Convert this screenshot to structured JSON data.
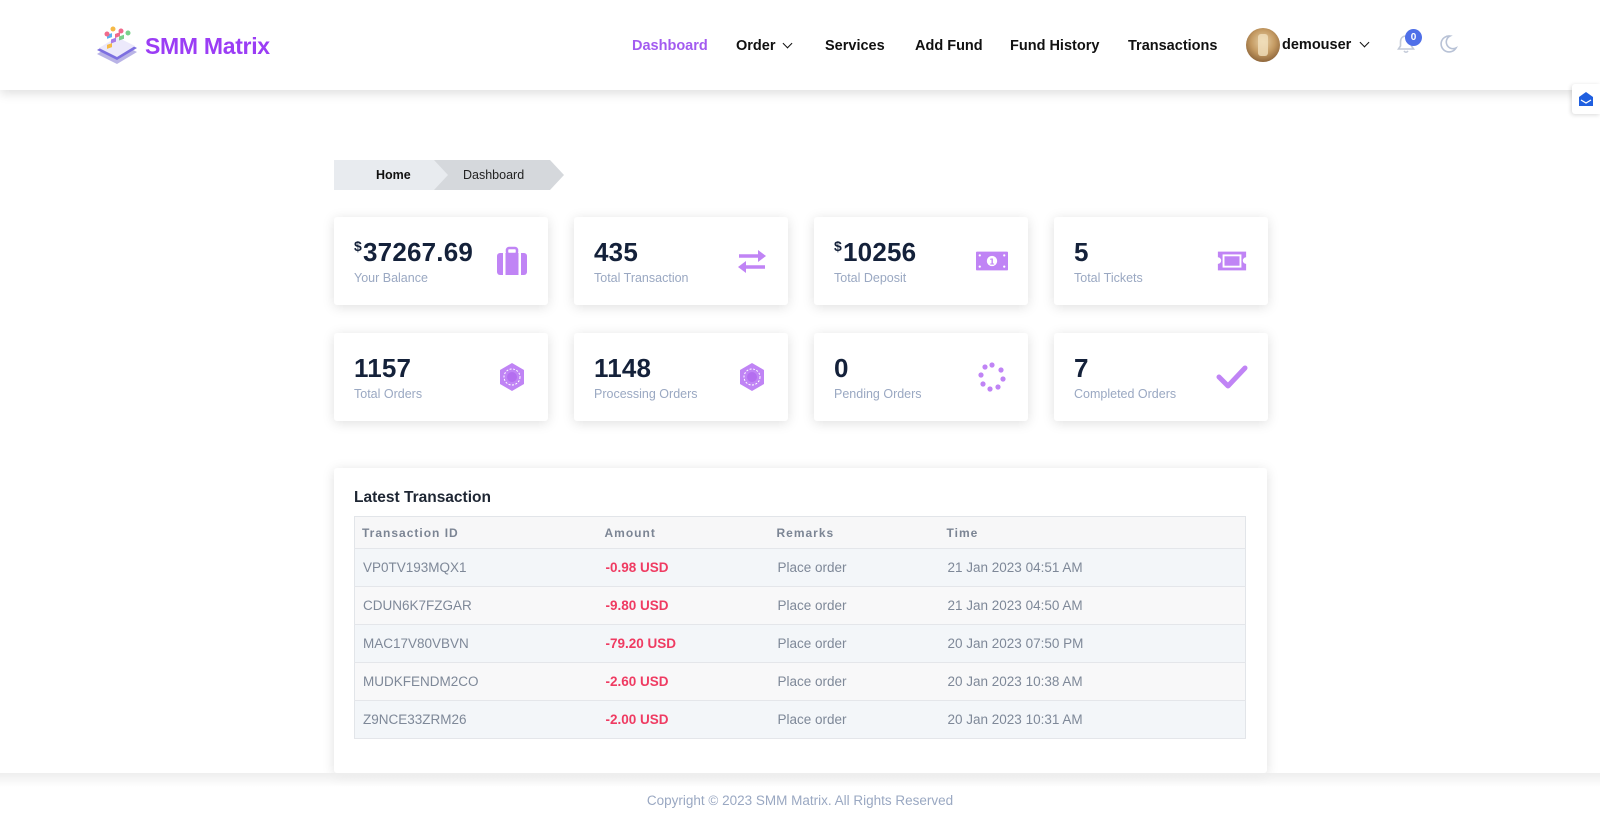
{
  "brand": {
    "name": "SMM Matrix",
    "accent_color": "#9b3df5"
  },
  "nav": {
    "items": [
      {
        "label": "Dashboard",
        "active": true
      },
      {
        "label": "Order",
        "has_dropdown": true
      },
      {
        "label": "Services"
      },
      {
        "label": "Add Fund"
      },
      {
        "label": "Fund History"
      },
      {
        "label": "Transactions"
      }
    ]
  },
  "user": {
    "name": "demouser",
    "notification_count": "0"
  },
  "breadcrumb": {
    "home": "Home",
    "current": "Dashboard"
  },
  "stats": [
    {
      "currency": "$",
      "value": "37267.69",
      "label": "Your Balance",
      "icon": "briefcase-icon"
    },
    {
      "currency": "",
      "value": "435",
      "label": "Total Transaction",
      "icon": "exchange-arrows-icon"
    },
    {
      "currency": "$",
      "value": "10256",
      "label": "Total Deposit",
      "icon": "money-bill-icon"
    },
    {
      "currency": "",
      "value": "5",
      "label": "Total Tickets",
      "icon": "ticket-icon"
    },
    {
      "currency": "",
      "value": "1157",
      "label": "Total Orders",
      "icon": "hexagon-gear-icon"
    },
    {
      "currency": "",
      "value": "1148",
      "label": "Processing Orders",
      "icon": "hexagon-gear-icon"
    },
    {
      "currency": "",
      "value": "0",
      "label": "Pending Orders",
      "icon": "spinner-dots-icon"
    },
    {
      "currency": "",
      "value": "7",
      "label": "Completed Orders",
      "icon": "check-icon"
    }
  ],
  "latest_transaction": {
    "title": "Latest Transaction",
    "columns": [
      "Transaction ID",
      "Amount",
      "Remarks",
      "Time"
    ],
    "rows": [
      {
        "id": "VP0TV193MQX1",
        "amount": "-0.98 USD",
        "remarks": "Place order",
        "time": "21 Jan 2023 04:51 AM"
      },
      {
        "id": "CDUN6K7FZGAR",
        "amount": "-9.80 USD",
        "remarks": "Place order",
        "time": "21 Jan 2023 04:50 AM"
      },
      {
        "id": "MAC17V80VBVN",
        "amount": "-79.20 USD",
        "remarks": "Place order",
        "time": "20 Jan 2023 07:50 PM"
      },
      {
        "id": "MUDKFENDM2CO",
        "amount": "-2.60 USD",
        "remarks": "Place order",
        "time": "20 Jan 2023 10:38 AM"
      },
      {
        "id": "Z9NCE33ZRM26",
        "amount": "-2.00 USD",
        "remarks": "Place order",
        "time": "20 Jan 2023 10:31 AM"
      }
    ]
  },
  "footer": {
    "text": "Copyright © 2023 SMM Matrix. All Rights Reserved"
  },
  "colors": {
    "icon_purple": "#c084f5",
    "negative_amount": "#ef3b62",
    "nav_active": "#a35bf0",
    "badge": "#4f6fe8"
  }
}
